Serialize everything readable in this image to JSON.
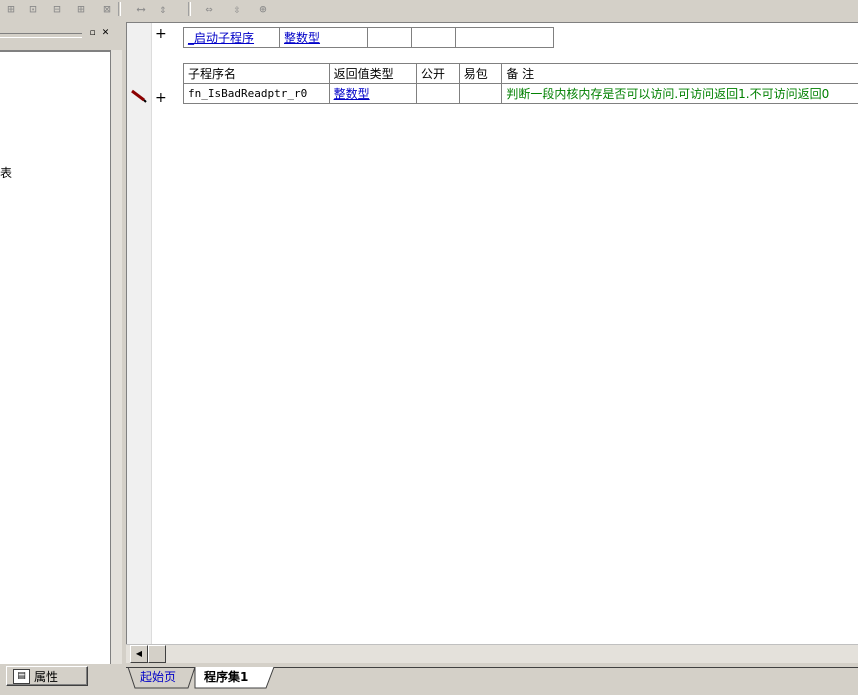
{
  "toolbar": {
    "icons": [
      "table-insert-icon",
      "table-col-icon",
      "table-row-icon",
      "table-split-icon",
      "col-width-icon",
      "row-height-icon",
      "hmerge-icon",
      "vmerge-icon",
      "cell-merge-icon"
    ]
  },
  "left_panel": {
    "tree_fragment": "表",
    "properties_tab_label": "属性"
  },
  "editor": {
    "assembly_row": {
      "name": "_启动子程序",
      "type": "整数型",
      "plus": "+"
    },
    "headers": {
      "sub_name": "子程序名",
      "return_type": "返回值类型",
      "public": "公开",
      "easy_pack": "易包",
      "remark": "备 注"
    },
    "sub_row": {
      "name": "fn_IsBadReadptr_r0",
      "return_type": "整数型",
      "public": "",
      "easy_pack": "",
      "remark": "判断一段内核内存是否可以访问.可访问返回1.不可访问返回0",
      "plus": "+"
    }
  },
  "doc_tabs": [
    {
      "label": "起始页"
    },
    {
      "label": "程序集1"
    }
  ],
  "colors": {
    "keyword_blue": "#0000c8",
    "remark_green": "#008000",
    "window_gray": "#d4d0c8"
  }
}
